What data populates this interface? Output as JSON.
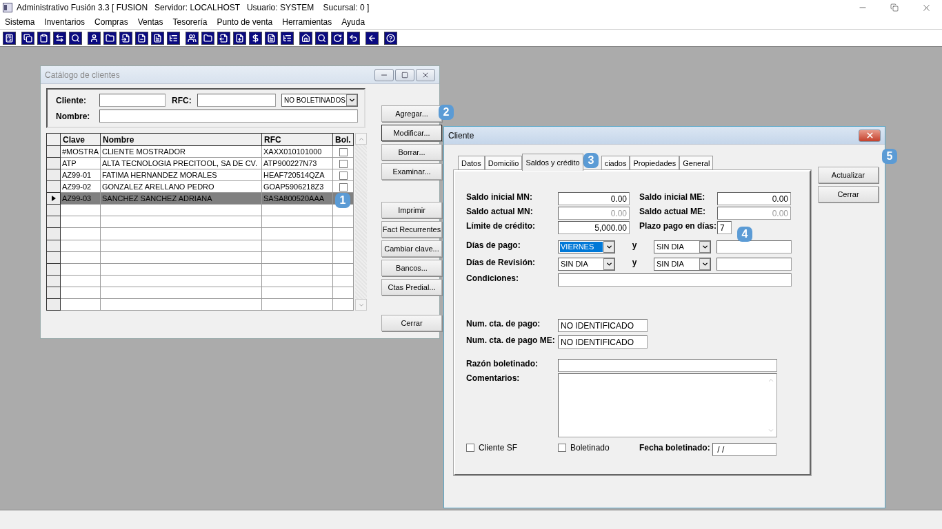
{
  "app": {
    "title": "Administrativo Fusión 3.3 [ FUSION   Servidor: LOCALHOST   Usuario: SYSTEM    Sucursal: 0 ]"
  },
  "menu": [
    "Sistema",
    "Inventarios",
    "Compras",
    "Ventas",
    "Tesorería",
    "Punto de venta",
    "Herramientas",
    "Ayuda"
  ],
  "toolbar": [
    [
      {
        "kind": "calc"
      }
    ],
    [
      {
        "kind": "copy"
      },
      {
        "kind": "clipboard"
      },
      {
        "kind": "swap"
      },
      {
        "kind": "search"
      }
    ],
    [
      {
        "kind": "person"
      },
      {
        "kind": "folder"
      },
      {
        "kind": "doc_in"
      },
      {
        "kind": "doc_minus"
      },
      {
        "kind": "doc"
      },
      {
        "kind": "list"
      }
    ],
    [
      {
        "kind": "people"
      },
      {
        "kind": "folder"
      },
      {
        "kind": "doc_out"
      },
      {
        "kind": "doc_plus"
      },
      {
        "kind": "dollar"
      },
      {
        "kind": "doc"
      },
      {
        "kind": "list"
      }
    ],
    [
      {
        "kind": "home"
      },
      {
        "kind": "search"
      },
      {
        "kind": "redo"
      },
      {
        "kind": "undo"
      }
    ],
    [
      {
        "kind": "back"
      }
    ],
    [
      {
        "kind": "help"
      }
    ]
  ],
  "catalog": {
    "title": "Catálogo de clientes",
    "filters": {
      "cliente_label": "Cliente:",
      "rfc_label": "RFC:",
      "nombre_label": "Nombre:",
      "status": "NO BOLETINADOS"
    },
    "columns": [
      "Clave",
      "Nombre",
      "RFC",
      "Bol."
    ],
    "rows": [
      {
        "clave": "#MOSTRA",
        "nombre": "CLIENTE MOSTRADOR",
        "rfc": "XAXX010101000",
        "selected": false,
        "boletinado": false
      },
      {
        "clave": "ATP",
        "nombre": "ALTA TECNOLOGIA PRECITOOL, SA DE CV.",
        "rfc": "ATP900227N73",
        "selected": false,
        "boletinado": false
      },
      {
        "clave": "AZ99-01",
        "nombre": "FATIMA HERNANDEZ MORALES",
        "rfc": "HEAF720514QZA",
        "selected": false,
        "boletinado": false
      },
      {
        "clave": "AZ99-02",
        "nombre": "GONZALEZ ARELLANO PEDRO",
        "rfc": "GOAP5906218Z3",
        "selected": false,
        "boletinado": false
      },
      {
        "clave": "AZ99-03",
        "nombre": "SANCHEZ SANCHEZ ADRIANA",
        "rfc": "SASA800520AAA",
        "selected": true
      }
    ],
    "buttons": [
      {
        "label": "Agregar...",
        "focused": false
      },
      {
        "label": "Modificar...",
        "focused": true
      },
      {
        "label": "Borrar...",
        "focused": false
      },
      {
        "label": "Examinar...",
        "focused": false
      },
      {
        "label": "Imprimir",
        "focused": false
      },
      {
        "label": "Fact Recurrentes",
        "focused": false
      },
      {
        "label": "Cambiar clave...",
        "focused": false
      },
      {
        "label": "Bancos...",
        "focused": false
      },
      {
        "label": "Ctas Predial...",
        "focused": false
      },
      {
        "label": "Cerrar",
        "focused": false
      }
    ]
  },
  "cliente": {
    "title": "Cliente",
    "tabs": [
      {
        "label": "Datos",
        "selected": false
      },
      {
        "label": "Domicilio",
        "selected": false
      },
      {
        "label": "Saldos y crédito",
        "selected": true
      },
      {
        "label": "ciados",
        "selected": false
      },
      {
        "label": "Propiedades",
        "selected": false
      },
      {
        "label": "General",
        "selected": false
      }
    ],
    "buttons": [
      "Actualizar",
      "Cerrar"
    ],
    "saldo_inicial_mn": {
      "label": "Saldo inicial MN:",
      "value": "0.00",
      "disabled": false
    },
    "saldo_inicial_me": {
      "label": "Saldo inicial ME:",
      "value": "0.00",
      "disabled": false
    },
    "saldo_actual_mn": {
      "label": "Saldo actual MN:",
      "value": "0.00",
      "disabled": true
    },
    "saldo_actual_me": {
      "label": "Saldo actual ME:",
      "value": "0.00",
      "disabled": true
    },
    "limite_credito": {
      "label": "Límite de crédito:",
      "value": "5,000.00",
      "disabled": false
    },
    "plazo_pago": {
      "label": "Plazo pago en días:",
      "value": "7"
    },
    "dias_pago": {
      "label": "Días de pago:",
      "first": {
        "value": "VIERNES",
        "selected": true
      },
      "joiner": "y",
      "second": {
        "value": "SIN DIA",
        "selected": false
      }
    },
    "dias_revision": {
      "label": "Días de Revisión:",
      "first": {
        "value": "SIN DIA",
        "selected": false
      },
      "joiner": "y",
      "second": {
        "value": "SIN DIA",
        "selected": false
      }
    },
    "condiciones": {
      "label": "Condiciones:"
    },
    "num_cta_pago": {
      "label": "Num. cta. de pago:",
      "value": "NO IDENTIFICADO"
    },
    "num_cta_pago_me": {
      "label": "Num. cta. de pago ME:",
      "value": "NO IDENTIFICADO"
    },
    "razon_boletinado": {
      "label": "Razón boletinado:"
    },
    "comentarios": {
      "label": "Comentarios:"
    },
    "cliente_sf": {
      "label": "Cliente SF",
      "checked": false
    },
    "boletinado": {
      "label": "Boletinado",
      "checked": false
    },
    "fecha_boletinado": {
      "label": "Fecha boletinado:",
      "value": " / /"
    }
  },
  "badges": [
    "1",
    "2",
    "3",
    "4",
    "5"
  ]
}
